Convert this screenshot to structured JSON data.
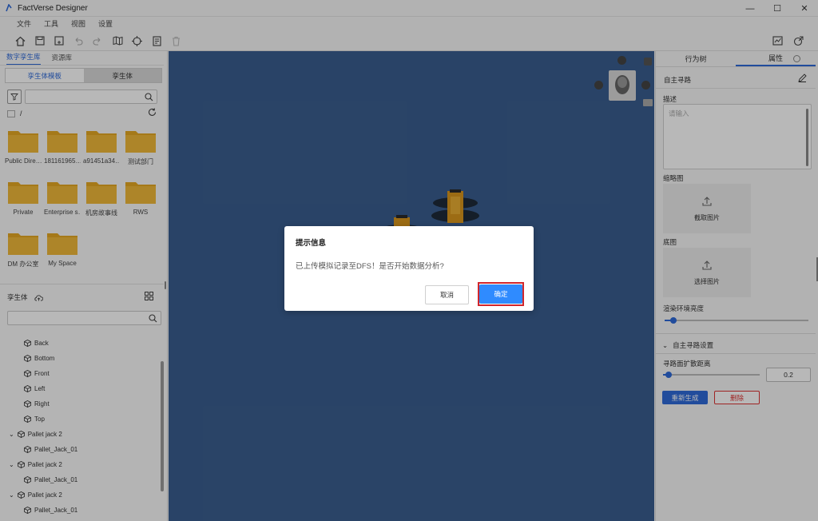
{
  "window": {
    "title": "FactVerse Designer",
    "min": "—",
    "max": "☐",
    "close": "✕"
  },
  "menu": [
    "文件",
    "工具",
    "视图",
    "设置"
  ],
  "left_panel": {
    "tabs": [
      "数字孪生库",
      "资源库"
    ],
    "segments": [
      "孪生体模板",
      "孪生体"
    ],
    "path": "/",
    "folders": [
      "Public Dire…",
      "181161965…",
      "a91451a34…",
      "测试部门",
      "Private",
      "Enterprise s…",
      "机房故事线",
      "RWS",
      "DM 办公室",
      "My Space"
    ],
    "tree_header": "孪生体",
    "tree": [
      {
        "label": "Back",
        "level": 2
      },
      {
        "label": "Bottom",
        "level": 2
      },
      {
        "label": "Front",
        "level": 2
      },
      {
        "label": "Left",
        "level": 2
      },
      {
        "label": "Right",
        "level": 2
      },
      {
        "label": "Top",
        "level": 2
      },
      {
        "label": "Pallet jack 2",
        "level": 1
      },
      {
        "label": "Pallet_Jack_01",
        "level": 2
      },
      {
        "label": "Pallet jack 2",
        "level": 1
      },
      {
        "label": "Pallet_Jack_01",
        "level": 2
      },
      {
        "label": "Pallet jack 2",
        "level": 1
      },
      {
        "label": "Pallet_Jack_01",
        "level": 2
      }
    ]
  },
  "right_panel": {
    "tabs": [
      "行为树",
      "属性"
    ],
    "section_title": "自主寻路",
    "desc_label": "描述",
    "desc_placeholder": "请输入",
    "thumb_label": "缩略图",
    "thumb_upload": "截取图片",
    "floor_label": "底图",
    "floor_upload": "选择图片",
    "env_light_label": "渲染环境亮度",
    "env_light_value": 0.06,
    "nav_section": "自主寻路设置",
    "nav_distance_label": "寻路面扩散距离",
    "nav_distance_value": "0.2",
    "nav_slider_value": 0.06,
    "regen_button": "重新生成",
    "delete_button": "删除"
  },
  "dialog": {
    "title": "提示信息",
    "message": "已上传模拟记录至DFS！是否开始数据分析?",
    "cancel": "取消",
    "ok": "确定"
  },
  "colors": {
    "accent": "#2f6ad9",
    "viewport": "#3a5e8f",
    "highlight": "#d1262c",
    "folder": "#e5a823"
  }
}
